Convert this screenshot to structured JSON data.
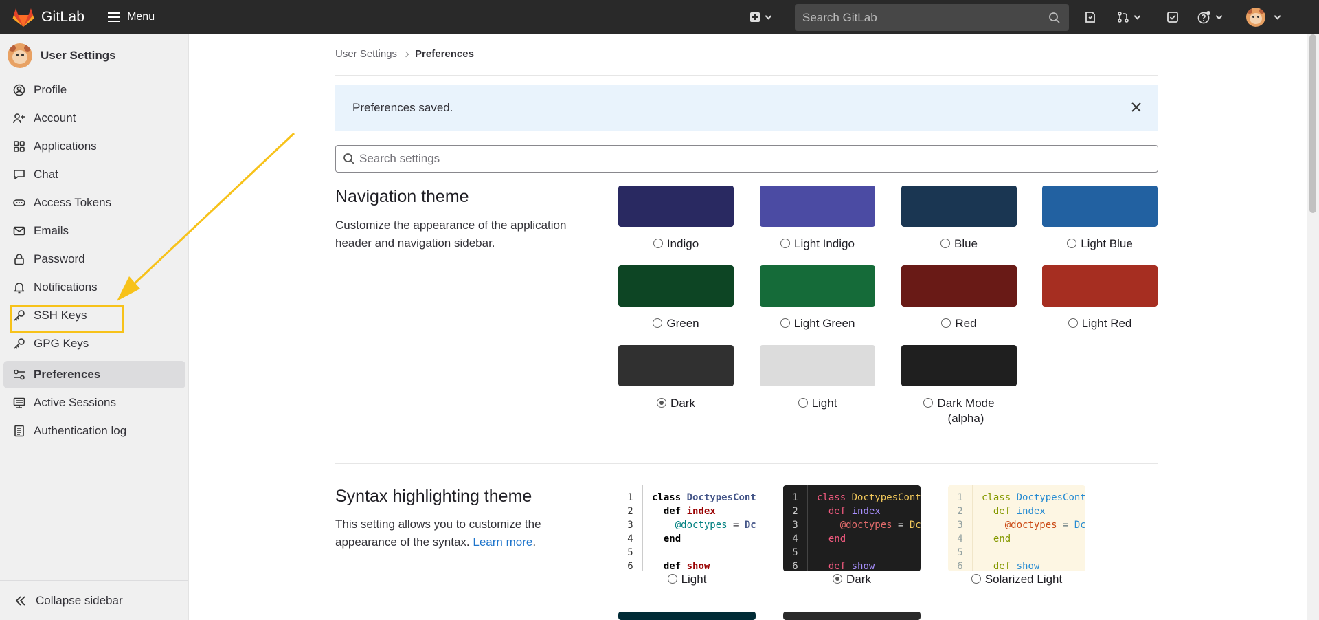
{
  "header": {
    "app_name": "GitLab",
    "menu_label": "Menu",
    "search_placeholder": "Search GitLab"
  },
  "sidebar": {
    "title": "User Settings",
    "items": [
      {
        "label": "Profile",
        "icon": "profile-icon"
      },
      {
        "label": "Account",
        "icon": "account-icon"
      },
      {
        "label": "Applications",
        "icon": "applications-icon"
      },
      {
        "label": "Chat",
        "icon": "chat-icon"
      },
      {
        "label": "Access Tokens",
        "icon": "token-icon"
      },
      {
        "label": "Emails",
        "icon": "mail-icon"
      },
      {
        "label": "Password",
        "icon": "lock-icon"
      },
      {
        "label": "Notifications",
        "icon": "bell-icon"
      },
      {
        "label": "SSH Keys",
        "icon": "key-icon"
      },
      {
        "label": "GPG Keys",
        "icon": "key-icon"
      },
      {
        "label": "Preferences",
        "icon": "preferences-icon",
        "active": true
      },
      {
        "label": "Active Sessions",
        "icon": "monitor-icon"
      },
      {
        "label": "Authentication log",
        "icon": "log-icon"
      }
    ],
    "collapse_label": "Collapse sidebar"
  },
  "breadcrumb": {
    "parent": "User Settings",
    "current": "Preferences"
  },
  "alert": {
    "message": "Preferences saved."
  },
  "settings_search": {
    "placeholder": "Search settings"
  },
  "navigation_theme": {
    "title": "Navigation theme",
    "description": "Customize the appearance of the application header and navigation sidebar.",
    "themes": [
      {
        "label": "Indigo",
        "color": "#292961",
        "selected": false
      },
      {
        "label": "Light Indigo",
        "color": "#4b4ba3",
        "selected": false
      },
      {
        "label": "Blue",
        "color": "#1a3652",
        "selected": false
      },
      {
        "label": "Light Blue",
        "color": "#2261a1",
        "selected": false
      },
      {
        "label": "Green",
        "color": "#0d4524",
        "selected": false
      },
      {
        "label": "Light Green",
        "color": "#156b39",
        "selected": false
      },
      {
        "label": "Red",
        "color": "#691a16",
        "selected": false
      },
      {
        "label": "Light Red",
        "color": "#a62e21",
        "selected": false
      },
      {
        "label": "Dark",
        "color": "#303030",
        "selected": true
      },
      {
        "label": "Light",
        "color": "#dcdcdc",
        "selected": false
      },
      {
        "label": "Dark Mode",
        "label2": "(alpha)",
        "color": "#1f1f1f",
        "selected": false
      }
    ]
  },
  "syntax_theme": {
    "title": "Syntax highlighting theme",
    "description": "This setting allows you to customize the appearance of the syntax.",
    "learn_more": "Learn more",
    "desc_end": ".",
    "themes": [
      {
        "label": "Light",
        "selected": false
      },
      {
        "label": "Dark",
        "selected": true
      },
      {
        "label": "Solarized Light",
        "selected": false
      }
    ],
    "code": {
      "line_numbers": [
        "1",
        "2",
        "3",
        "4",
        "5",
        "6"
      ],
      "kw_class": "class",
      "class_name": "DoctypesCont",
      "kw_def": "def",
      "fn_index": "index",
      "ivar": "@doctypes",
      "assign": " = ",
      "rhs": "Dc",
      "kw_end": "end",
      "fn_show": "show",
      "next_class": "class DoctypesCont"
    }
  },
  "colors": {
    "header_bg": "#292929",
    "accent": "#1f75cb",
    "annotation": "#f7c21a"
  }
}
